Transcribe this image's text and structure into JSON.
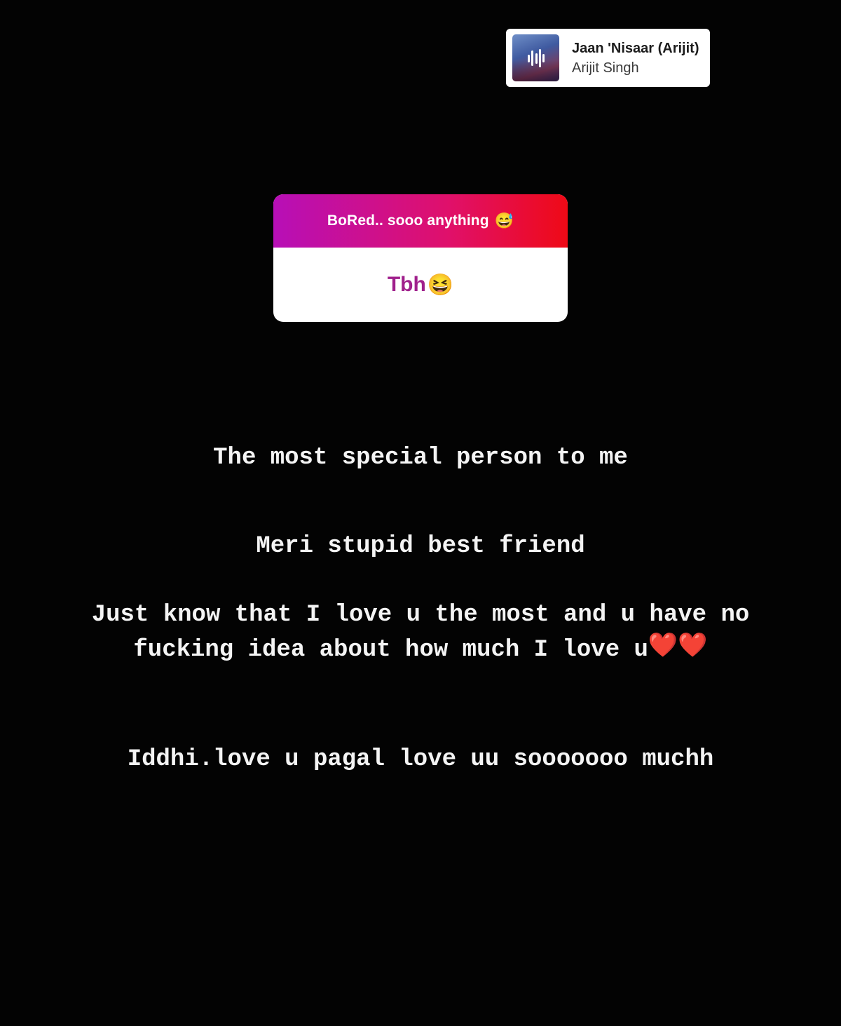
{
  "music_sticker": {
    "title": "Jaan 'Nisaar (Arijit)",
    "artist": "Arijit Singh",
    "album_art_icon": "equalizer-bars-icon"
  },
  "question_sticker": {
    "prompt": "BoRed.. sooo anything",
    "prompt_emoji": "😅",
    "answer": "Tbh",
    "answer_emoji": "😆",
    "colors": {
      "gradient_start": "#b70fb7",
      "gradient_end": "#ef0a16",
      "answer_text": "#a0208c"
    }
  },
  "story_text": {
    "line1": "The most special  person to me",
    "line2": "Meri stupid best friend",
    "line3": "Just know that I love u the most and u have no",
    "line4": "fucking idea about  how much I love u",
    "line4_emoji": "❤️❤️",
    "line5": "Iddhi.love u pagal love uu sooooooo muchh"
  }
}
